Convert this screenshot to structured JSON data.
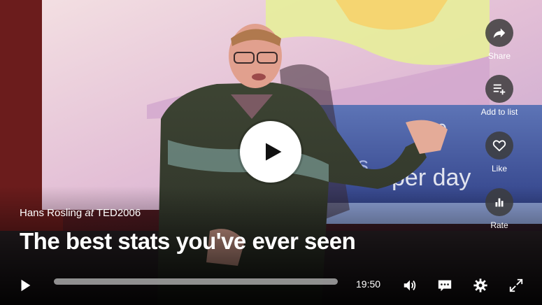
{
  "talk": {
    "speaker": "Hans Rosling",
    "at": "at",
    "event": "TED2006",
    "title": "The best stats you've ever seen"
  },
  "side_actions": [
    {
      "id": "share",
      "label": "Share",
      "icon": "share-arrow-icon"
    },
    {
      "id": "add-to-list",
      "label": "Add to list",
      "icon": "playlist-add-icon"
    },
    {
      "id": "like",
      "label": "Like",
      "icon": "heart-icon"
    },
    {
      "id": "rate",
      "label": "Rate",
      "icon": "bar-chart-icon"
    }
  ],
  "controls": {
    "duration": "19:50",
    "progress": 0.0,
    "icons": [
      "play-icon",
      "volume-icon",
      "subtitles-icon",
      "settings-gear-icon",
      "fullscreen-icon"
    ]
  },
  "colors": {
    "accent": "#e62b1e",
    "overlay_button": "#3c3c3c",
    "text": "#ffffff"
  }
}
